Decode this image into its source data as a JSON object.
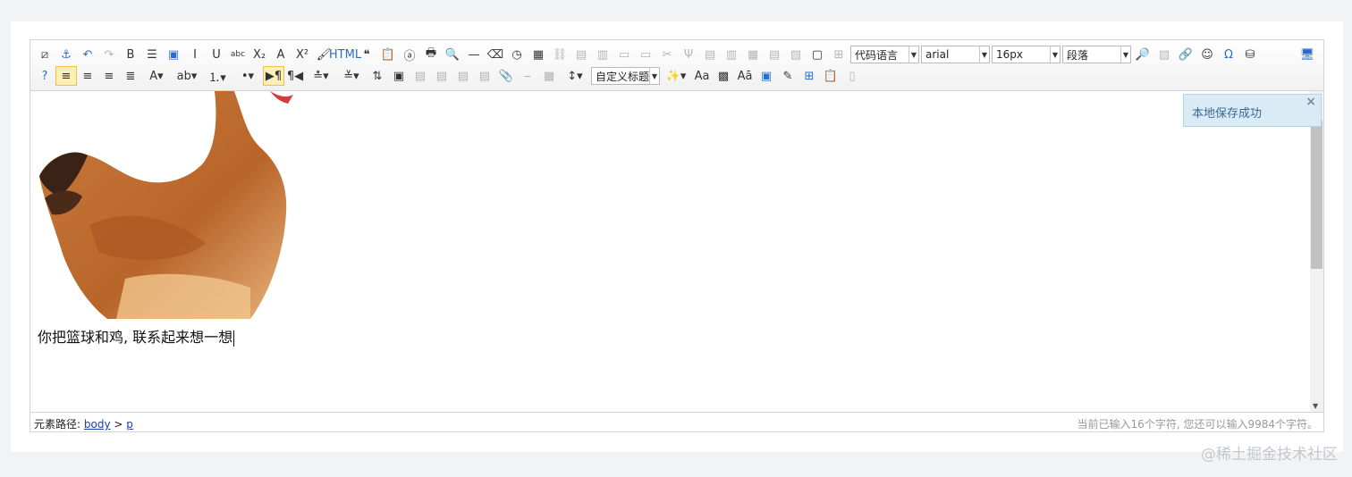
{
  "toolbar": {
    "row1": [
      {
        "name": "source-icon",
        "glyph": "⧄"
      },
      {
        "name": "anchor-icon",
        "glyph": "⚓",
        "cls": "blue"
      },
      {
        "name": "undo-icon",
        "glyph": "↶",
        "cls": "blue"
      },
      {
        "name": "redo-icon",
        "glyph": "↷",
        "cls": "disabled"
      },
      {
        "name": "bold-icon",
        "glyph": "B"
      },
      {
        "name": "indent-icon",
        "glyph": "☰"
      },
      {
        "name": "snapscreen-icon",
        "glyph": "▣",
        "cls": "blue"
      },
      {
        "name": "italic-icon",
        "glyph": "I"
      },
      {
        "name": "underline-icon",
        "glyph": "U"
      },
      {
        "name": "strikethrough-icon",
        "glyph": "abc"
      },
      {
        "name": "subscript-icon",
        "glyph": "X₂"
      },
      {
        "name": "fontborder-icon",
        "glyph": "A"
      },
      {
        "name": "superscript-icon",
        "glyph": "X²"
      },
      {
        "name": "formatmatch-icon",
        "glyph": "🖌"
      },
      {
        "name": "html-icon",
        "glyph": "HTML",
        "cls": "blue"
      },
      {
        "name": "blockquote-icon",
        "glyph": "❝"
      },
      {
        "name": "pasteplain-icon",
        "glyph": "📋"
      },
      {
        "name": "selectall-icon",
        "glyph": "ⓐ"
      },
      {
        "name": "print-icon",
        "glyph": "🖶"
      },
      {
        "name": "preview-icon",
        "glyph": "🔍"
      },
      {
        "name": "horizontal-icon",
        "glyph": "—"
      },
      {
        "name": "removeformat-icon",
        "glyph": "⌫"
      },
      {
        "name": "time-icon",
        "glyph": "◷"
      },
      {
        "name": "date-icon",
        "glyph": "▦"
      },
      {
        "name": "unlink-icon",
        "glyph": "⛓",
        "cls": "disabled"
      },
      {
        "name": "insertrow-icon",
        "glyph": "▤",
        "cls": "disabled"
      },
      {
        "name": "insertcol-icon",
        "glyph": "▥",
        "cls": "disabled"
      },
      {
        "name": "mergeright-icon",
        "glyph": "▭",
        "cls": "disabled"
      },
      {
        "name": "mergedown-icon",
        "glyph": "▭",
        "cls": "disabled"
      },
      {
        "name": "deleterow-icon",
        "glyph": "✂",
        "cls": "disabled"
      },
      {
        "name": "deletecol-icon",
        "glyph": "Ψ",
        "cls": "disabled"
      },
      {
        "name": "splittorows-icon",
        "glyph": "▤",
        "cls": "disabled"
      },
      {
        "name": "splittocols-icon",
        "glyph": "▥",
        "cls": "disabled"
      },
      {
        "name": "splittocells-icon",
        "glyph": "▦",
        "cls": "disabled"
      },
      {
        "name": "deletecaption-icon",
        "glyph": "▤",
        "cls": "disabled"
      },
      {
        "name": "inserttitle-icon",
        "glyph": "▧",
        "cls": "disabled"
      },
      {
        "name": "mergecells-icon",
        "glyph": "▢"
      },
      {
        "name": "deletetable-icon",
        "glyph": "⊞",
        "cls": "disabled"
      }
    ],
    "row1_tail": [
      {
        "name": "searchreplace-icon",
        "glyph": "🔎"
      },
      {
        "name": "map-icon",
        "glyph": "▨",
        "cls": "disabled"
      },
      {
        "name": "link-icon",
        "glyph": "🔗"
      },
      {
        "name": "emotion-icon",
        "glyph": "☺"
      },
      {
        "name": "spechars-icon",
        "glyph": "Ω",
        "cls": "blue"
      },
      {
        "name": "binoculars-icon",
        "glyph": "⛁"
      }
    ],
    "fullscreen_glyph": "🖥",
    "row2": [
      {
        "name": "help-icon",
        "glyph": "?",
        "cls": "blue"
      },
      {
        "name": "justify-left-icon",
        "glyph": "≡",
        "cls": "active"
      },
      {
        "name": "justify-right-icon",
        "glyph": "≡"
      },
      {
        "name": "justify-center-icon",
        "glyph": "≡"
      },
      {
        "name": "justify-justify-icon",
        "glyph": "≣"
      },
      {
        "name": "forecolor-icon",
        "glyph": "A▾",
        "cls": "wide"
      },
      {
        "name": "backcolor-icon",
        "glyph": "ab▾",
        "cls": "wide"
      },
      {
        "name": "ordered-list-icon",
        "glyph": "⒈▾",
        "cls": "wide"
      },
      {
        "name": "unordered-list-icon",
        "glyph": "•▾",
        "cls": "wide"
      },
      {
        "name": "direction-ltr-icon",
        "glyph": "▶¶",
        "cls": "active"
      },
      {
        "name": "direction-rtl-icon",
        "glyph": "¶◀"
      },
      {
        "name": "rowspacing-top-icon",
        "glyph": "≛▾",
        "cls": "wide"
      },
      {
        "name": "rowspacing-bottom-icon",
        "glyph": "≚▾",
        "cls": "wide"
      },
      {
        "name": "touppercase-icon",
        "glyph": "⇅"
      },
      {
        "name": "insertimage-icon",
        "glyph": "▣"
      },
      {
        "name": "imagenone-icon",
        "glyph": "▤",
        "cls": "disabled"
      },
      {
        "name": "imageleft-icon",
        "glyph": "▤",
        "cls": "disabled"
      },
      {
        "name": "imageright-icon",
        "glyph": "▤",
        "cls": "disabled"
      },
      {
        "name": "imagecenter-icon",
        "glyph": "▤",
        "cls": "disabled"
      },
      {
        "name": "attachment-icon",
        "glyph": "📎"
      },
      {
        "name": "pagebreak-icon",
        "glyph": "⎯",
        "cls": "disabled"
      },
      {
        "name": "wordimage-icon",
        "glyph": "▦",
        "cls": "disabled"
      },
      {
        "name": "lineheight-icon",
        "glyph": "↕▾",
        "cls": "wide"
      }
    ],
    "row2_tail": [
      {
        "name": "magic-icon",
        "glyph": "✨▾",
        "cls": "wide"
      },
      {
        "name": "fontsize-icon",
        "glyph": "Aa"
      },
      {
        "name": "insertframe-icon",
        "glyph": "▩"
      },
      {
        "name": "template-icon",
        "glyph": "Aā"
      },
      {
        "name": "background-icon",
        "glyph": "▣",
        "cls": "blue"
      },
      {
        "name": "scrawl-icon",
        "glyph": "✎"
      },
      {
        "name": "inserttable-icon",
        "glyph": "⊞",
        "cls": "blue"
      },
      {
        "name": "insertcode-icon",
        "glyph": "📋"
      },
      {
        "name": "drafts-icon",
        "glyph": "▯",
        "cls": "disabled"
      }
    ],
    "combos": {
      "code_language": "代码语言",
      "font_family": "arial",
      "font_size": "16px",
      "paragraph": "段落",
      "custom_title": "自定义标题"
    }
  },
  "content": {
    "paragraph": "你把篮球和鸡, 联系起来想一想"
  },
  "toast": {
    "message": "本地保存成功",
    "close": "×"
  },
  "statusbar": {
    "path_label": "元素路径:",
    "path_body": "body",
    "path_sep": ">",
    "path_p": "p",
    "count": "当前已输入16个字符, 您还可以输入9984个字符。"
  },
  "watermark": "@稀土掘金技术社区"
}
